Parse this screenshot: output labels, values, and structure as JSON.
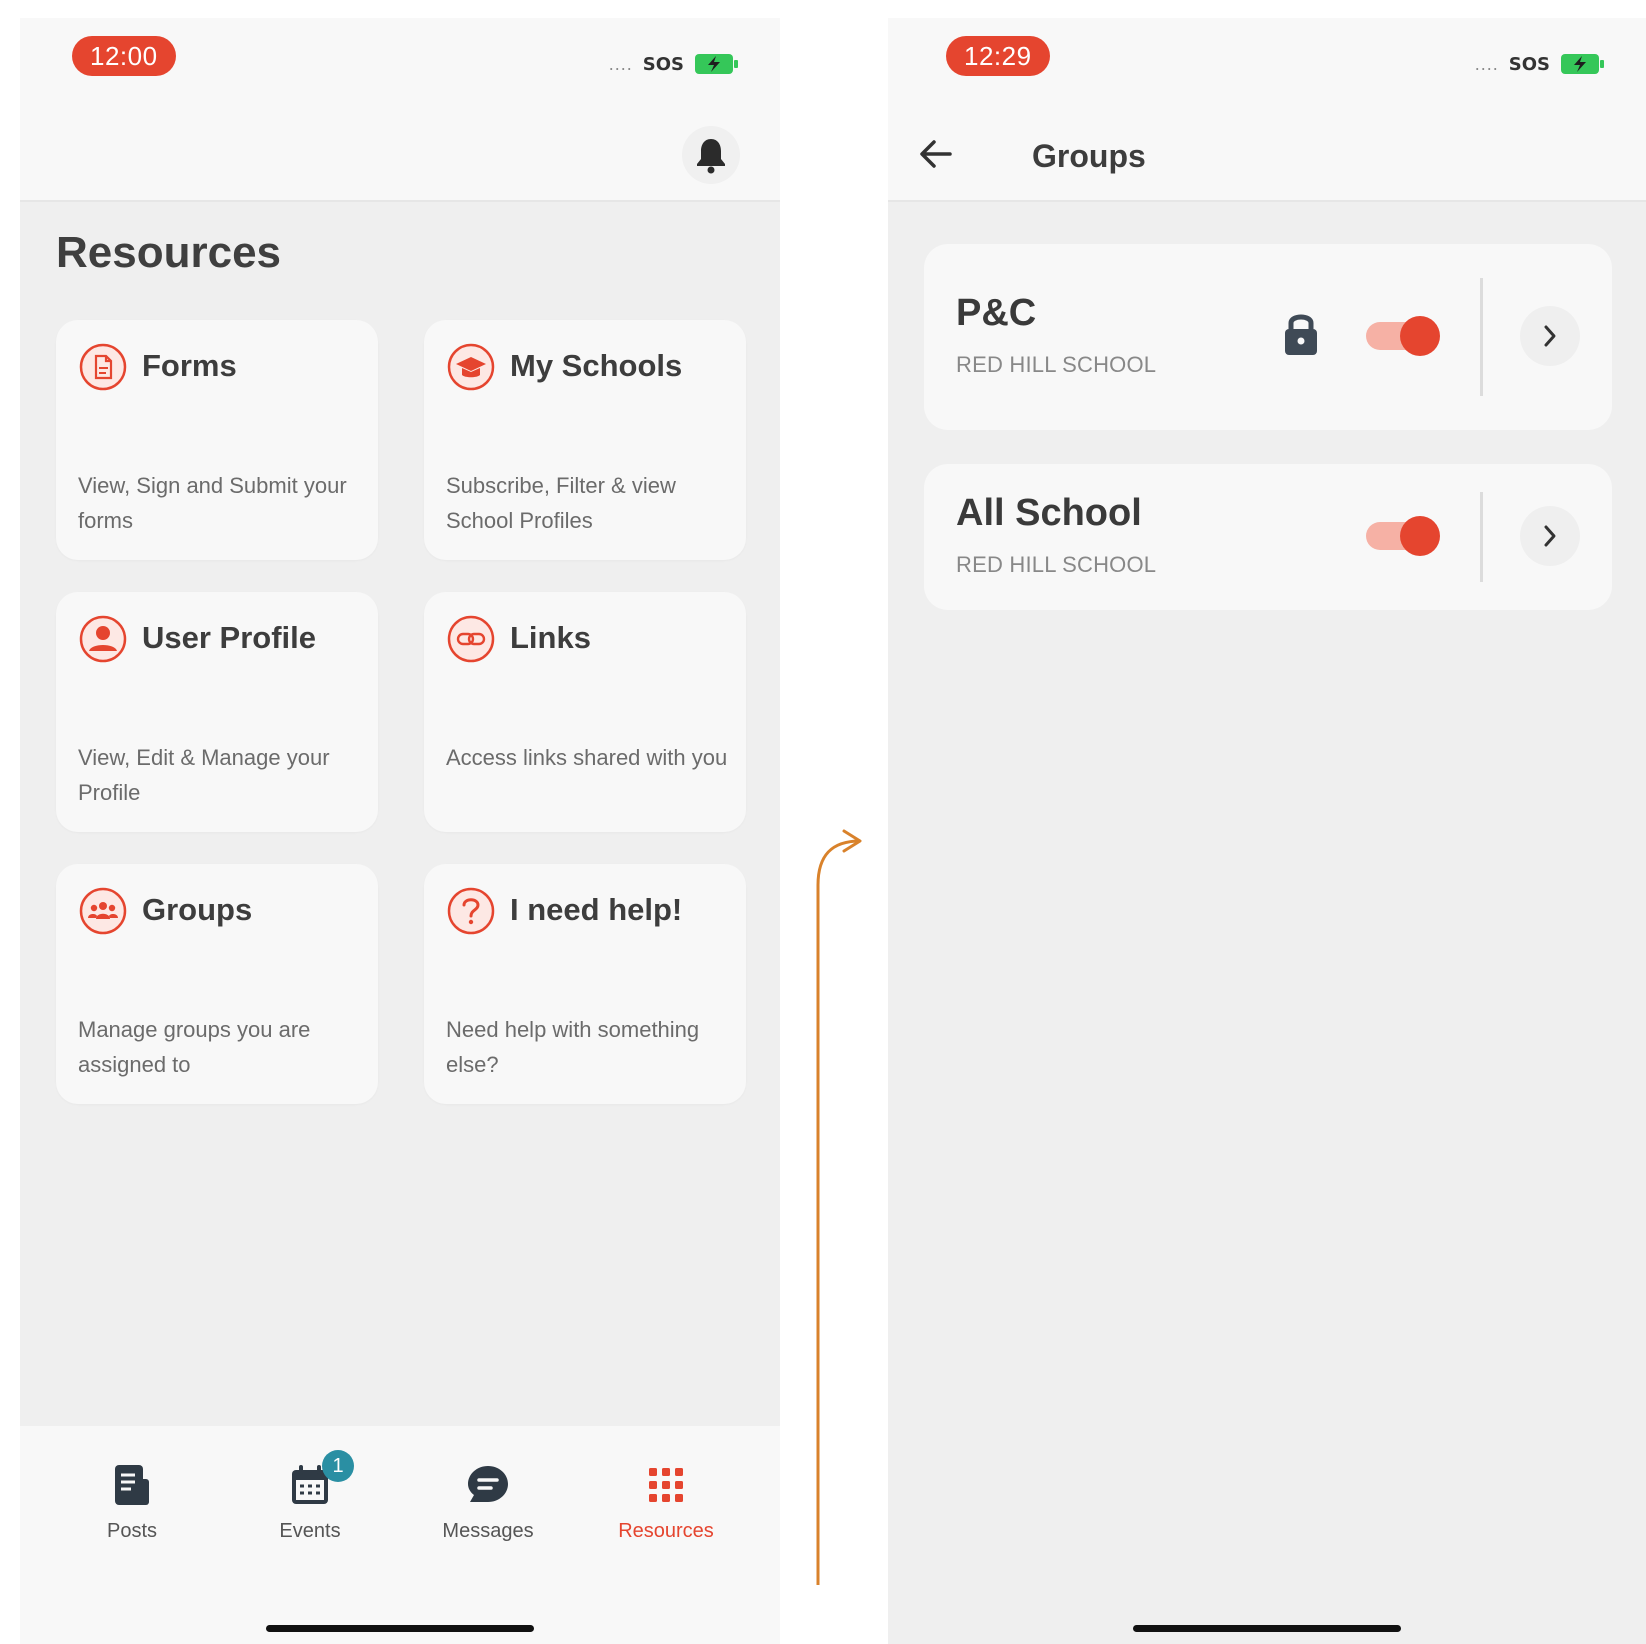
{
  "left_screen": {
    "status": {
      "time": "12:00",
      "signal": "....",
      "sos": "SOS"
    },
    "title": "Resources",
    "cards": [
      {
        "title": "Forms",
        "desc": "View, Sign and Submit your forms",
        "icon": "form-document-icon"
      },
      {
        "title": "My Schools",
        "desc": "Subscribe, Filter & view School Profiles",
        "icon": "graduation-cap-icon"
      },
      {
        "title": "User Profile",
        "desc": "View, Edit & Manage your Profile",
        "icon": "user-icon"
      },
      {
        "title": "Links",
        "desc": "Access links shared with you",
        "icon": "link-icon"
      },
      {
        "title": "Groups",
        "desc": "Manage groups you are assigned to",
        "icon": "people-group-icon"
      },
      {
        "title": "I need help!",
        "desc": "Need help with something else?",
        "icon": "question-mark-icon"
      }
    ],
    "nav": [
      {
        "label": "Posts",
        "icon": "posts-icon",
        "active": false
      },
      {
        "label": "Events",
        "icon": "calendar-icon",
        "badge": "1",
        "active": false
      },
      {
        "label": "Messages",
        "icon": "chat-bubble-icon",
        "active": false
      },
      {
        "label": "Resources",
        "icon": "grid-icon",
        "active": true
      }
    ]
  },
  "right_screen": {
    "status": {
      "time": "12:29",
      "signal": "....",
      "sos": "SOS"
    },
    "title": "Groups",
    "groups": [
      {
        "name": "P&C",
        "school": "RED HILL SCHOOL",
        "locked": true,
        "enabled": true
      },
      {
        "name": "All School",
        "school": "RED HILL SCHOOL",
        "locked": false,
        "enabled": true
      }
    ]
  },
  "colors": {
    "accent": "#e5452f",
    "badge": "#2a8fa3",
    "connector": "#d9822b",
    "battery": "#35c759"
  }
}
